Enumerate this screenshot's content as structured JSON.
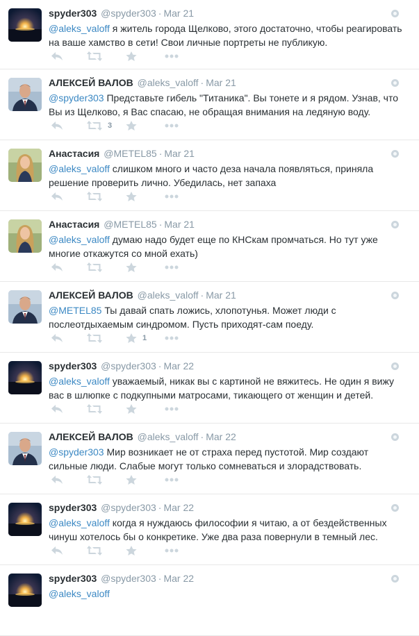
{
  "tweets": [
    {
      "avatar": "sunset-avatar",
      "name": "spyder303",
      "handle": "@spyder303",
      "sep": "·",
      "time": "Mar 21",
      "mention": "@aleks_valoff",
      "text": " я житель города Щелково, этого достаточно, чтобы реагировать на ваше хамство в сети! Свои личные портреты не публикую.",
      "retweets": "",
      "favorites": ""
    },
    {
      "avatar": "man-suit-avatar",
      "name": "АЛЕКСЕЙ ВАЛОВ",
      "handle": "@aleks_valoff",
      "sep": "·",
      "time": "Mar 21",
      "mention": "@spyder303",
      "text": " Представьте гибель \"Титаника\". Вы тонете и я рядом. Узнав, что Вы из Щелково, я Вас спасаю, не обращая внимания на ледяную воду.",
      "retweets": "3",
      "favorites": ""
    },
    {
      "avatar": "woman-avatar",
      "name": "Анастасия",
      "handle": "@METEL85",
      "sep": "·",
      "time": "Mar 21",
      "mention": "@aleks_valoff",
      "text": " слишком много и часто деза начала появляться, приняла решение проверить лично. Убедилась, нет запаха",
      "retweets": "",
      "favorites": ""
    },
    {
      "avatar": "woman-avatar",
      "name": "Анастасия",
      "handle": "@METEL85",
      "sep": "·",
      "time": "Mar 21",
      "mention": "@aleks_valoff",
      "text": " думаю надо будет еще по КНСкам промчаться. Но тут уже многие откажутся со мной ехать)",
      "retweets": "",
      "favorites": ""
    },
    {
      "avatar": "man-suit-avatar",
      "name": "АЛЕКСЕЙ ВАЛОВ",
      "handle": "@aleks_valoff",
      "sep": "·",
      "time": "Mar 21",
      "mention": "@METEL85",
      "text": " Ты давай спать ложись, хлопотунья. Может люди с послеотдыхаемым синдромом. Пусть приходят-сам поеду.",
      "retweets": "",
      "favorites": "1"
    },
    {
      "avatar": "sunset-avatar",
      "name": "spyder303",
      "handle": "@spyder303",
      "sep": "·",
      "time": "Mar 22",
      "mention": "@aleks_valoff",
      "text": " уважаемый, никак вы с картиной не вяжитесь. Не один я вижу вас в шлюпке с подкупными матросами, тикающего от женщин и детей.",
      "retweets": "",
      "favorites": ""
    },
    {
      "avatar": "man-suit-avatar",
      "name": "АЛЕКСЕЙ ВАЛОВ",
      "handle": "@aleks_valoff",
      "sep": "·",
      "time": "Mar 22",
      "mention": "@spyder303",
      "text": " Мир возникает не от страха перед пустотой. Мир создают сильные люди. Слабые могут только сомневаться и злорадствовать.",
      "retweets": "",
      "favorites": ""
    },
    {
      "avatar": "sunset-avatar",
      "name": "spyder303",
      "handle": "@spyder303",
      "sep": "·",
      "time": "Mar 22",
      "mention": "@aleks_valoff",
      "text": " когда я нуждаюсь философии я читаю, а от бездейственных чинуш хотелось бы о конкретике. Уже два раза повернули в темный лес.",
      "retweets": "",
      "favorites": ""
    },
    {
      "avatar": "sunset-avatar",
      "name": "spyder303",
      "handle": "@spyder303",
      "sep": "·",
      "time": "Mar 22",
      "mention": "@aleks_valoff",
      "text": "",
      "retweets": "",
      "favorites": ""
    }
  ]
}
